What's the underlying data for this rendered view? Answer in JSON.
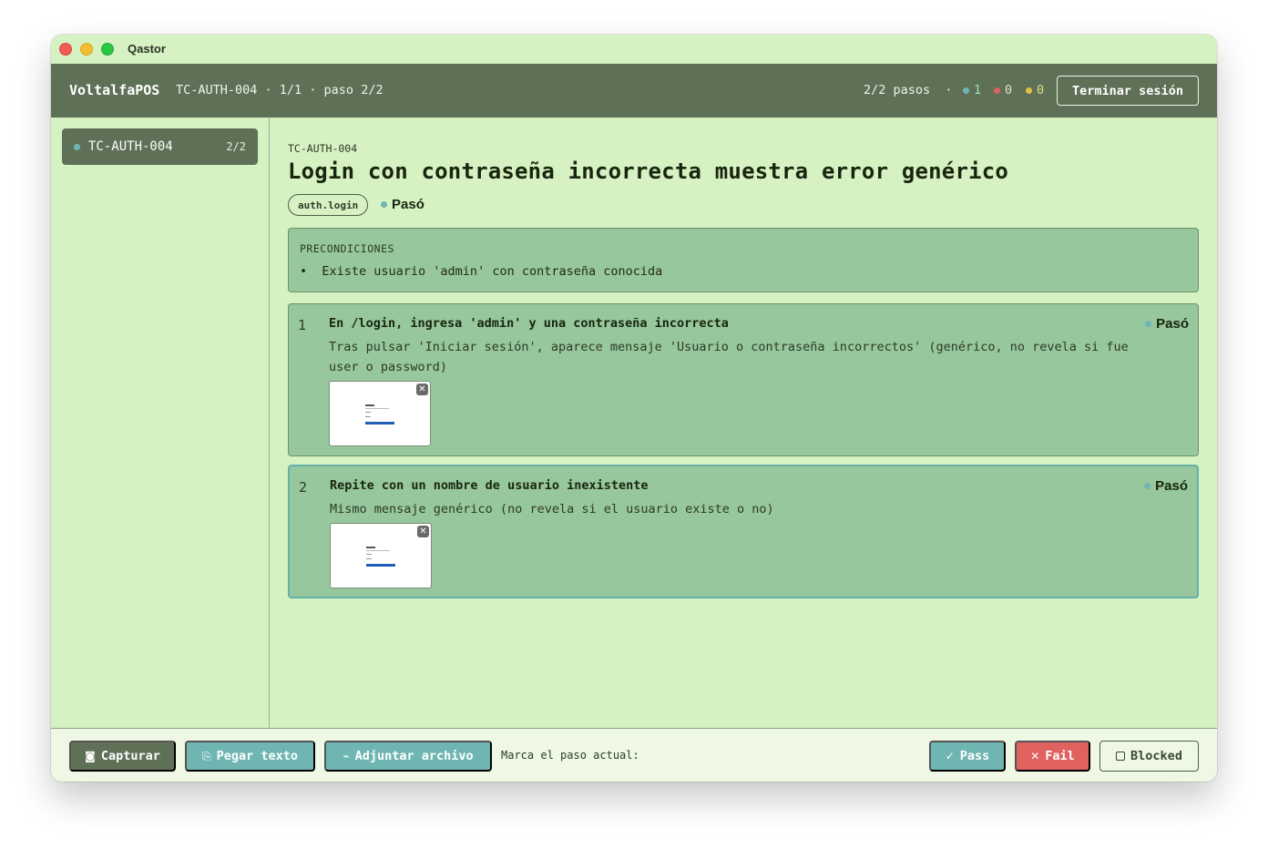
{
  "window": {
    "title": "Qastor"
  },
  "header": {
    "brand": "VoltalfaPOS",
    "case_info": "TC-AUTH-004 · 1/1 · paso 2/2",
    "steps_info": "2/2 pasos  ·",
    "counts": {
      "pass": "1",
      "fail": "0",
      "blocked": "0"
    },
    "end_session_label": "Terminar sesión"
  },
  "sidebar": {
    "items": [
      {
        "label": "TC-AUTH-004",
        "count": "2/2"
      }
    ]
  },
  "main": {
    "case_id": "TC-AUTH-004",
    "title": "Login con contraseña incorrecta muestra error genérico",
    "tag": "auth.login",
    "status": "Pasó",
    "preconditions": {
      "heading": "PRECONDICIONES",
      "items": [
        "•  Existe usuario 'admin' con contraseña conocida"
      ]
    },
    "steps": [
      {
        "number": "1",
        "title": "En /login, ingresa 'admin' y una contraseña incorrecta",
        "description": "Tras pulsar 'Iniciar sesión', aparece mensaje 'Usuario o contraseña incorrectos' (genérico, no revela si fue user o password)",
        "status": "Pasó"
      },
      {
        "number": "2",
        "title": "Repite con un nombre de usuario inexistente",
        "description": "Mismo mensaje genérico (no revela si el usuario existe o no)",
        "status": "Pasó"
      }
    ]
  },
  "footer": {
    "capturar": "Capturar",
    "pegar": "Pegar texto",
    "adjuntar": "Adjuntar archivo",
    "marca": "Marca el paso actual:",
    "pass": "Pass",
    "fail": "Fail",
    "blocked": "Blocked"
  },
  "colors": {
    "accent": "#5e7157",
    "teal": "#6fb6b3",
    "fail": "#e0625f",
    "background": "#d6f2c2",
    "card": "#97c79c"
  },
  "icons": {
    "capturar": "camera-icon",
    "pegar": "clipboard-icon",
    "adjuntar": "paperclip-icon",
    "pass": "check-icon",
    "fail": "x-icon",
    "blocked": "square-icon"
  }
}
